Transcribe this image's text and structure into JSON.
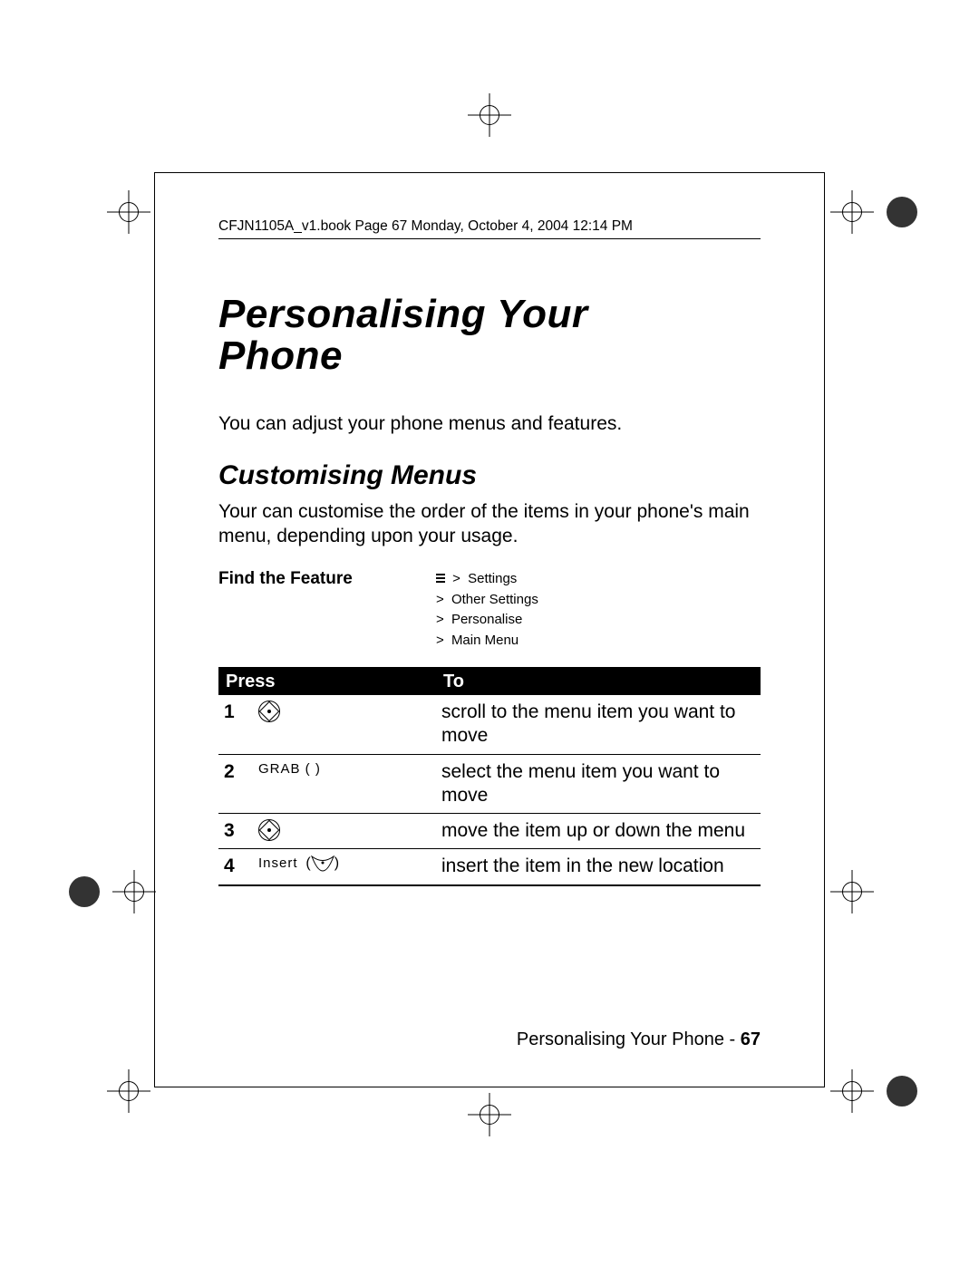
{
  "header_line": "CFJN1105A_v1.book  Page 67  Monday, October 4, 2004  12:14 PM",
  "title_line1": "Personalising Your",
  "title_line2": "Phone",
  "intro": "You can adjust your phone menus and features.",
  "section_heading": "Customising Menus",
  "section_body": "Your can customise the order of the items in your phone's main menu, depending upon your usage.",
  "find_feature_label": "Find the Feature",
  "nav": {
    "l1": "Settings",
    "l2": "Other Settings",
    "l3": "Personalise",
    "l4": "Main Menu"
  },
  "table": {
    "head_press": "Press",
    "head_to": "To",
    "rows": [
      {
        "num": "1",
        "press_label": "",
        "press_icon": "nav",
        "to": "scroll to the menu item you want to move"
      },
      {
        "num": "2",
        "press_label": "GRAB (      )",
        "press_icon": "",
        "to": "select the menu item you want to move"
      },
      {
        "num": "3",
        "press_label": "",
        "press_icon": "nav",
        "to": "move the item up or down the menu"
      },
      {
        "num": "4",
        "press_label": "Insert",
        "press_icon": "ok",
        "to": "insert the item in the new location"
      }
    ]
  },
  "footer_text": "Personalising Your Phone - ",
  "footer_page": "67"
}
